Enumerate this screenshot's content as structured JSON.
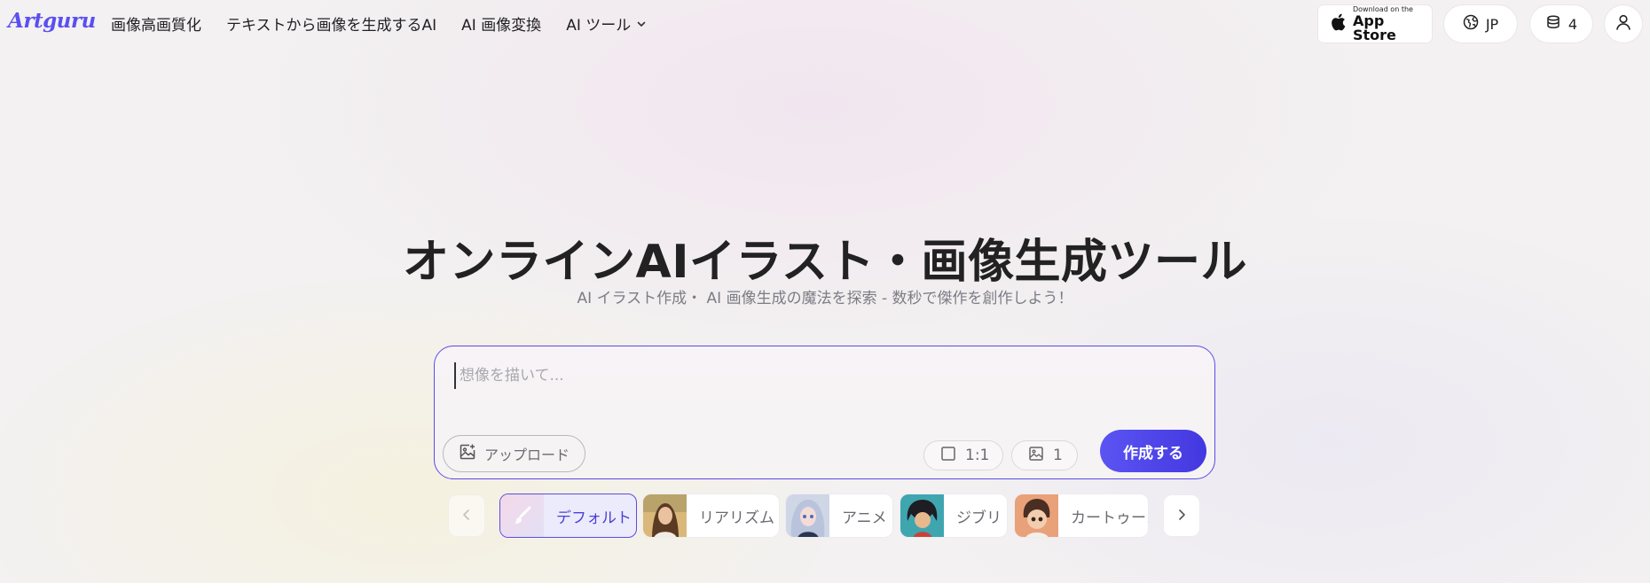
{
  "header": {
    "logo": "Artguru",
    "nav": [
      {
        "label": "画像高画質化"
      },
      {
        "label": "テキストから画像を生成するAI"
      },
      {
        "label": "AI 画像変換"
      },
      {
        "label": "AI ツール"
      }
    ],
    "appstore": {
      "small": "Download on the",
      "big": "App Store"
    },
    "language": "JP",
    "credits": "4"
  },
  "hero": {
    "title": "オンラインAIイラスト・画像生成ツール",
    "subtitle": "AI イラスト作成・ AI 画像生成の魔法を探索 - 数秒で傑作を創作しよう！"
  },
  "prompt": {
    "placeholder": "想像を描いて...",
    "value": "",
    "upload_label": "アップロード",
    "ratio": "1:1",
    "count": "1",
    "create_label": "作成する"
  },
  "styles": {
    "items": [
      {
        "label": "デフォルト",
        "active": true
      },
      {
        "label": "リアリズム",
        "active": false
      },
      {
        "label": "アニメ",
        "active": false
      },
      {
        "label": "ジブリ",
        "active": false
      },
      {
        "label": "カートゥーン",
        "active": false
      }
    ]
  },
  "colors": {
    "accent": "#5a4be6",
    "logo": "#5b4ff0",
    "create_button": "#4a40e8"
  }
}
